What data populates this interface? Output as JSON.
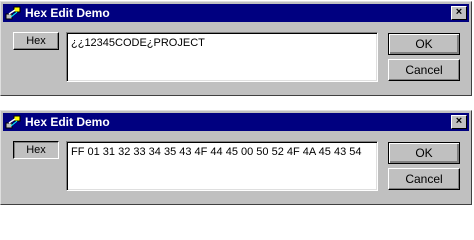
{
  "colors": {
    "titlebar": "#000080",
    "face": "#c0c0c0"
  },
  "dialogs": [
    {
      "title": "Hex Edit Demo",
      "icon": "app-icon",
      "hex_label": "Hex",
      "hex_pressed": false,
      "edit_value": "¿¿12345CODE¿PROJECT",
      "ok_label": "OK",
      "cancel_label": "Cancel",
      "close_glyph": "×"
    },
    {
      "title": "Hex Edit Demo",
      "icon": "app-icon",
      "hex_label": "Hex",
      "hex_pressed": true,
      "edit_value": "FF 01 31 32 33 34 35 43 4F 44 45 00 50 52 4F 4A 45 43 54",
      "ok_label": "OK",
      "cancel_label": "Cancel",
      "close_glyph": "×"
    }
  ]
}
